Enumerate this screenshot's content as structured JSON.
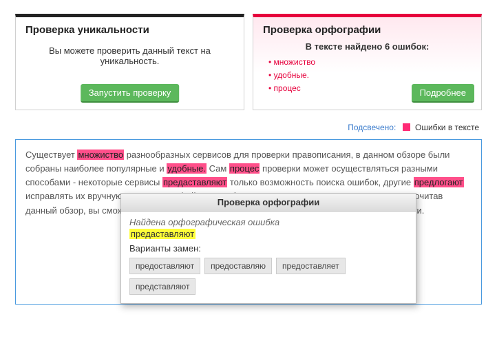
{
  "uniq": {
    "title": "Проверка уникальности",
    "body": "Вы можете проверить данный текст на уникальность.",
    "button": "Запустить проверку"
  },
  "spell": {
    "title": "Проверка орфографии",
    "found": "В тексте найдено 6 ошибок:",
    "errors": [
      "множиство",
      "удобные.",
      "процес"
    ],
    "button": "Подробнее"
  },
  "legend": {
    "label": "Подсвечено:",
    "type": "Ошибки в тексте"
  },
  "text": {
    "p1a": "Существует ",
    "e1": "множиство",
    "p1b": " разнообразных сервисов для проверки правописания, в данном обзоре были собраны наиболее популярные и ",
    "e2": "удобные.",
    "p1c": " Сам ",
    "e3": "процес",
    "p1d": " проверки может осуществляться разными способами - некоторые сервисы ",
    "e4": "предаставляют",
    "p1e": " только возможность поиска ошибок, другие ",
    "e5": "предлогают",
    "p1f": " исправлять их вручную. Также интерфейс может быть разным, в зависимости от сервиса. Прочитав данный обзор, вы сможете подобрать для себя подходящий инструмент проверки грамотности."
  },
  "popup": {
    "title": "Проверка орфографии",
    "msg": "Найдена орфографическая ошибка",
    "word": "предаставляют",
    "label": "Варианты замен:",
    "suggestions": [
      "предоставляют",
      "предоставляю",
      "предоставляет",
      "представляют"
    ]
  }
}
